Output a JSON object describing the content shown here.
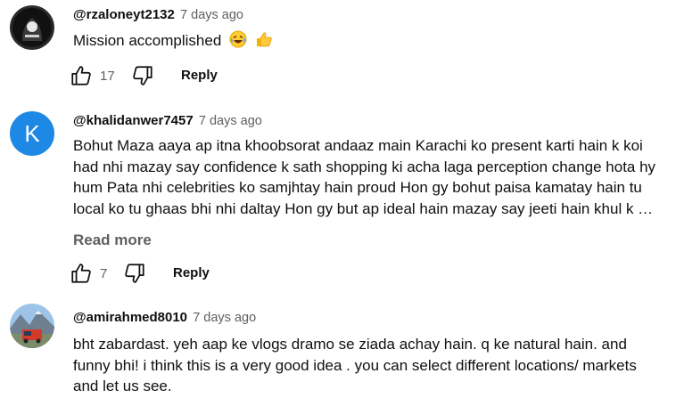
{
  "comments": [
    {
      "handle": "@rzaloneyt2132",
      "time": "7 days ago",
      "text": "Mission accomplished",
      "likes": "17",
      "reply_label": "Reply"
    },
    {
      "handle": "@khalidanwer7457",
      "avatar_letter": "K",
      "time": "7 days ago",
      "lines": [
        "Bohut Maza aaya ap itna khoobsorat andaaz main Karachi ko present karti hain k koi",
        "had nhi mazay say confidence k sath shopping ki acha laga perception change hota hy",
        "hum Pata nhi celebrities ko samjhtay hain proud Hon gy bohut paisa kamatay hain tu",
        "local ko tu ghaas bhi nhi daltay Hon gy but ap ideal hain mazay say jeeti hain khul k …"
      ],
      "read_more": "Read more",
      "likes": "7",
      "reply_label": "Reply"
    },
    {
      "handle": "@amirahmed8010",
      "time": "7 days ago",
      "lines": [
        "bht zabardast. yeh aap ke vlogs  dramo se ziada achay hain. q ke natural hain. and",
        "funny bhi!  i think this is a very good idea . you can select different locations/ markets",
        "and let us see."
      ]
    }
  ],
  "colors": {
    "avatar_k": "#1e88e5",
    "meta": "#606060",
    "text": "#0f0f0f"
  },
  "icons": [
    "like-icon",
    "dislike-icon",
    "laughing-emoji-icon",
    "thumbs-up-emoji-icon"
  ]
}
